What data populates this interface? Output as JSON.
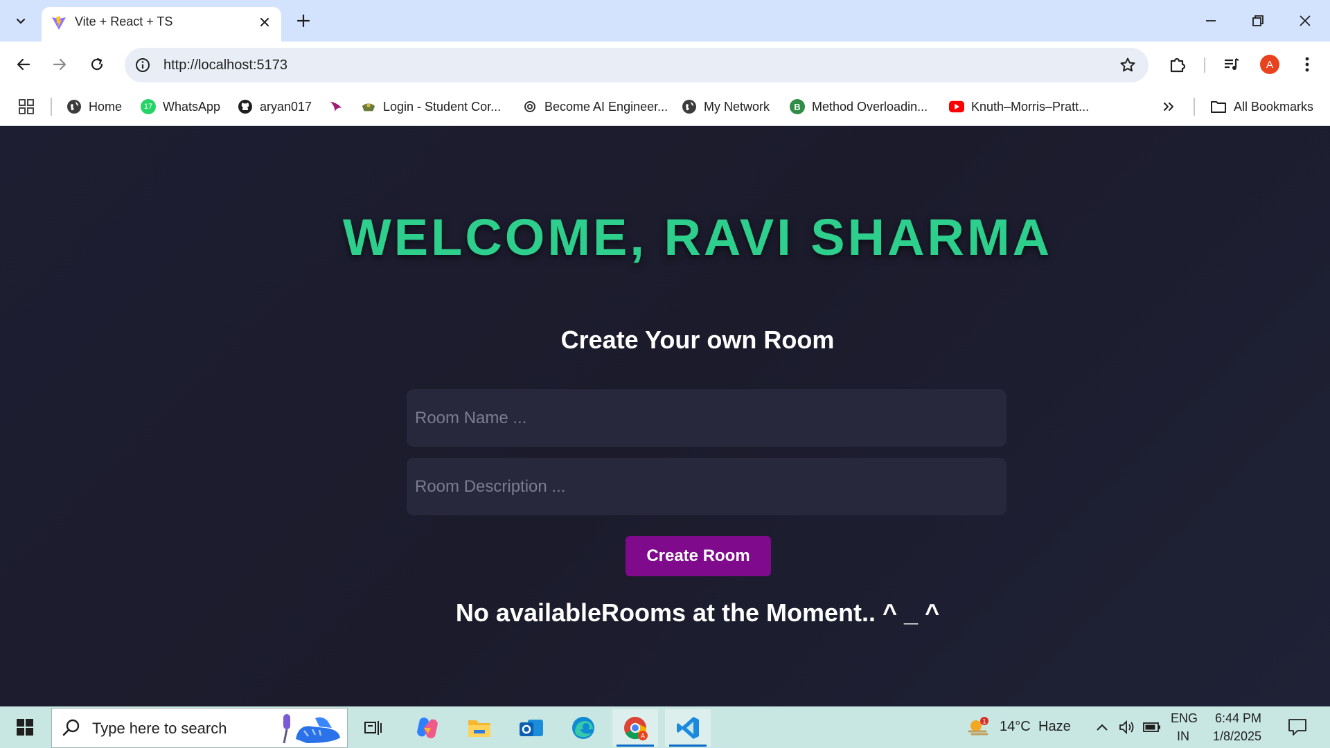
{
  "browser": {
    "tab_title": "Vite + React + TS",
    "url": "http://localhost:5173",
    "profile_initial": "A",
    "bookmarks": [
      {
        "label": "Home",
        "icon": "globe-icon"
      },
      {
        "label": "WhatsApp",
        "icon": "whatsapp-icon",
        "badge": "17"
      },
      {
        "label": "aryan017",
        "icon": "github-icon"
      },
      {
        "label": "",
        "icon": "arrow-logo-icon"
      },
      {
        "label": "Login - Student Cor...",
        "icon": "crest-icon"
      },
      {
        "label": "Become AI Engineer...",
        "icon": "openai-icon"
      },
      {
        "label": "My Network",
        "icon": "globe-icon"
      },
      {
        "label": "Method Overloadin...",
        "icon": "b-logo-icon"
      },
      {
        "label": "Knuth–Morris–Pratt...",
        "icon": "youtube-icon"
      }
    ],
    "all_bookmarks_label": "All Bookmarks"
  },
  "page": {
    "welcome": "WELCOME, RAVI SHARMA",
    "create_title": "Create Your own Room",
    "room_name_placeholder": "Room Name ...",
    "room_description_placeholder": "Room Description ...",
    "create_button": "Create Room",
    "no_rooms": "No availableRooms at the Moment.. ^ _ ^"
  },
  "taskbar": {
    "search_placeholder": "Type here to search",
    "weather_temp": "14°C",
    "weather_desc": "Haze",
    "weather_badge": "1",
    "lang_top": "ENG",
    "lang_bottom": "IN",
    "time": "6:44 PM",
    "date": "1/8/2025"
  },
  "colors": {
    "accent_green": "#2ecf8c",
    "button_purple": "#800a8c",
    "page_background": "#1c1d2e"
  }
}
